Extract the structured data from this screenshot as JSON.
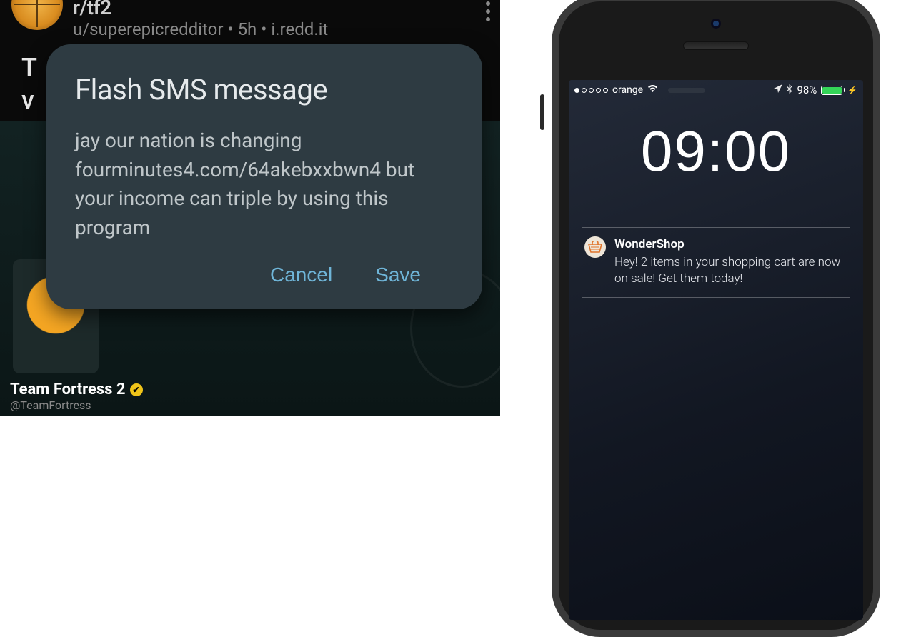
{
  "reddit": {
    "subreddit": "r/tf2",
    "author": "u/superepicredditor",
    "age": "5h",
    "domain": "i.redd.it",
    "post_title_line1": "T",
    "post_title_line2": "v",
    "overlay_title": "Team Fortress 2",
    "overlay_handle": "@TeamFortress"
  },
  "dialog": {
    "title": "Flash SMS message",
    "body": "jay our nation is changing fourminutes4.com/64akebxxbwn4 but your income can triple by using this program",
    "cancel": "Cancel",
    "save": "Save"
  },
  "phone": {
    "carrier": "orange",
    "battery_pct": "98%",
    "time": "09:00",
    "notif_app": "WonderShop",
    "notif_body": "Hey! 2 items in your shopping cart are now on sale! Get them today!"
  }
}
